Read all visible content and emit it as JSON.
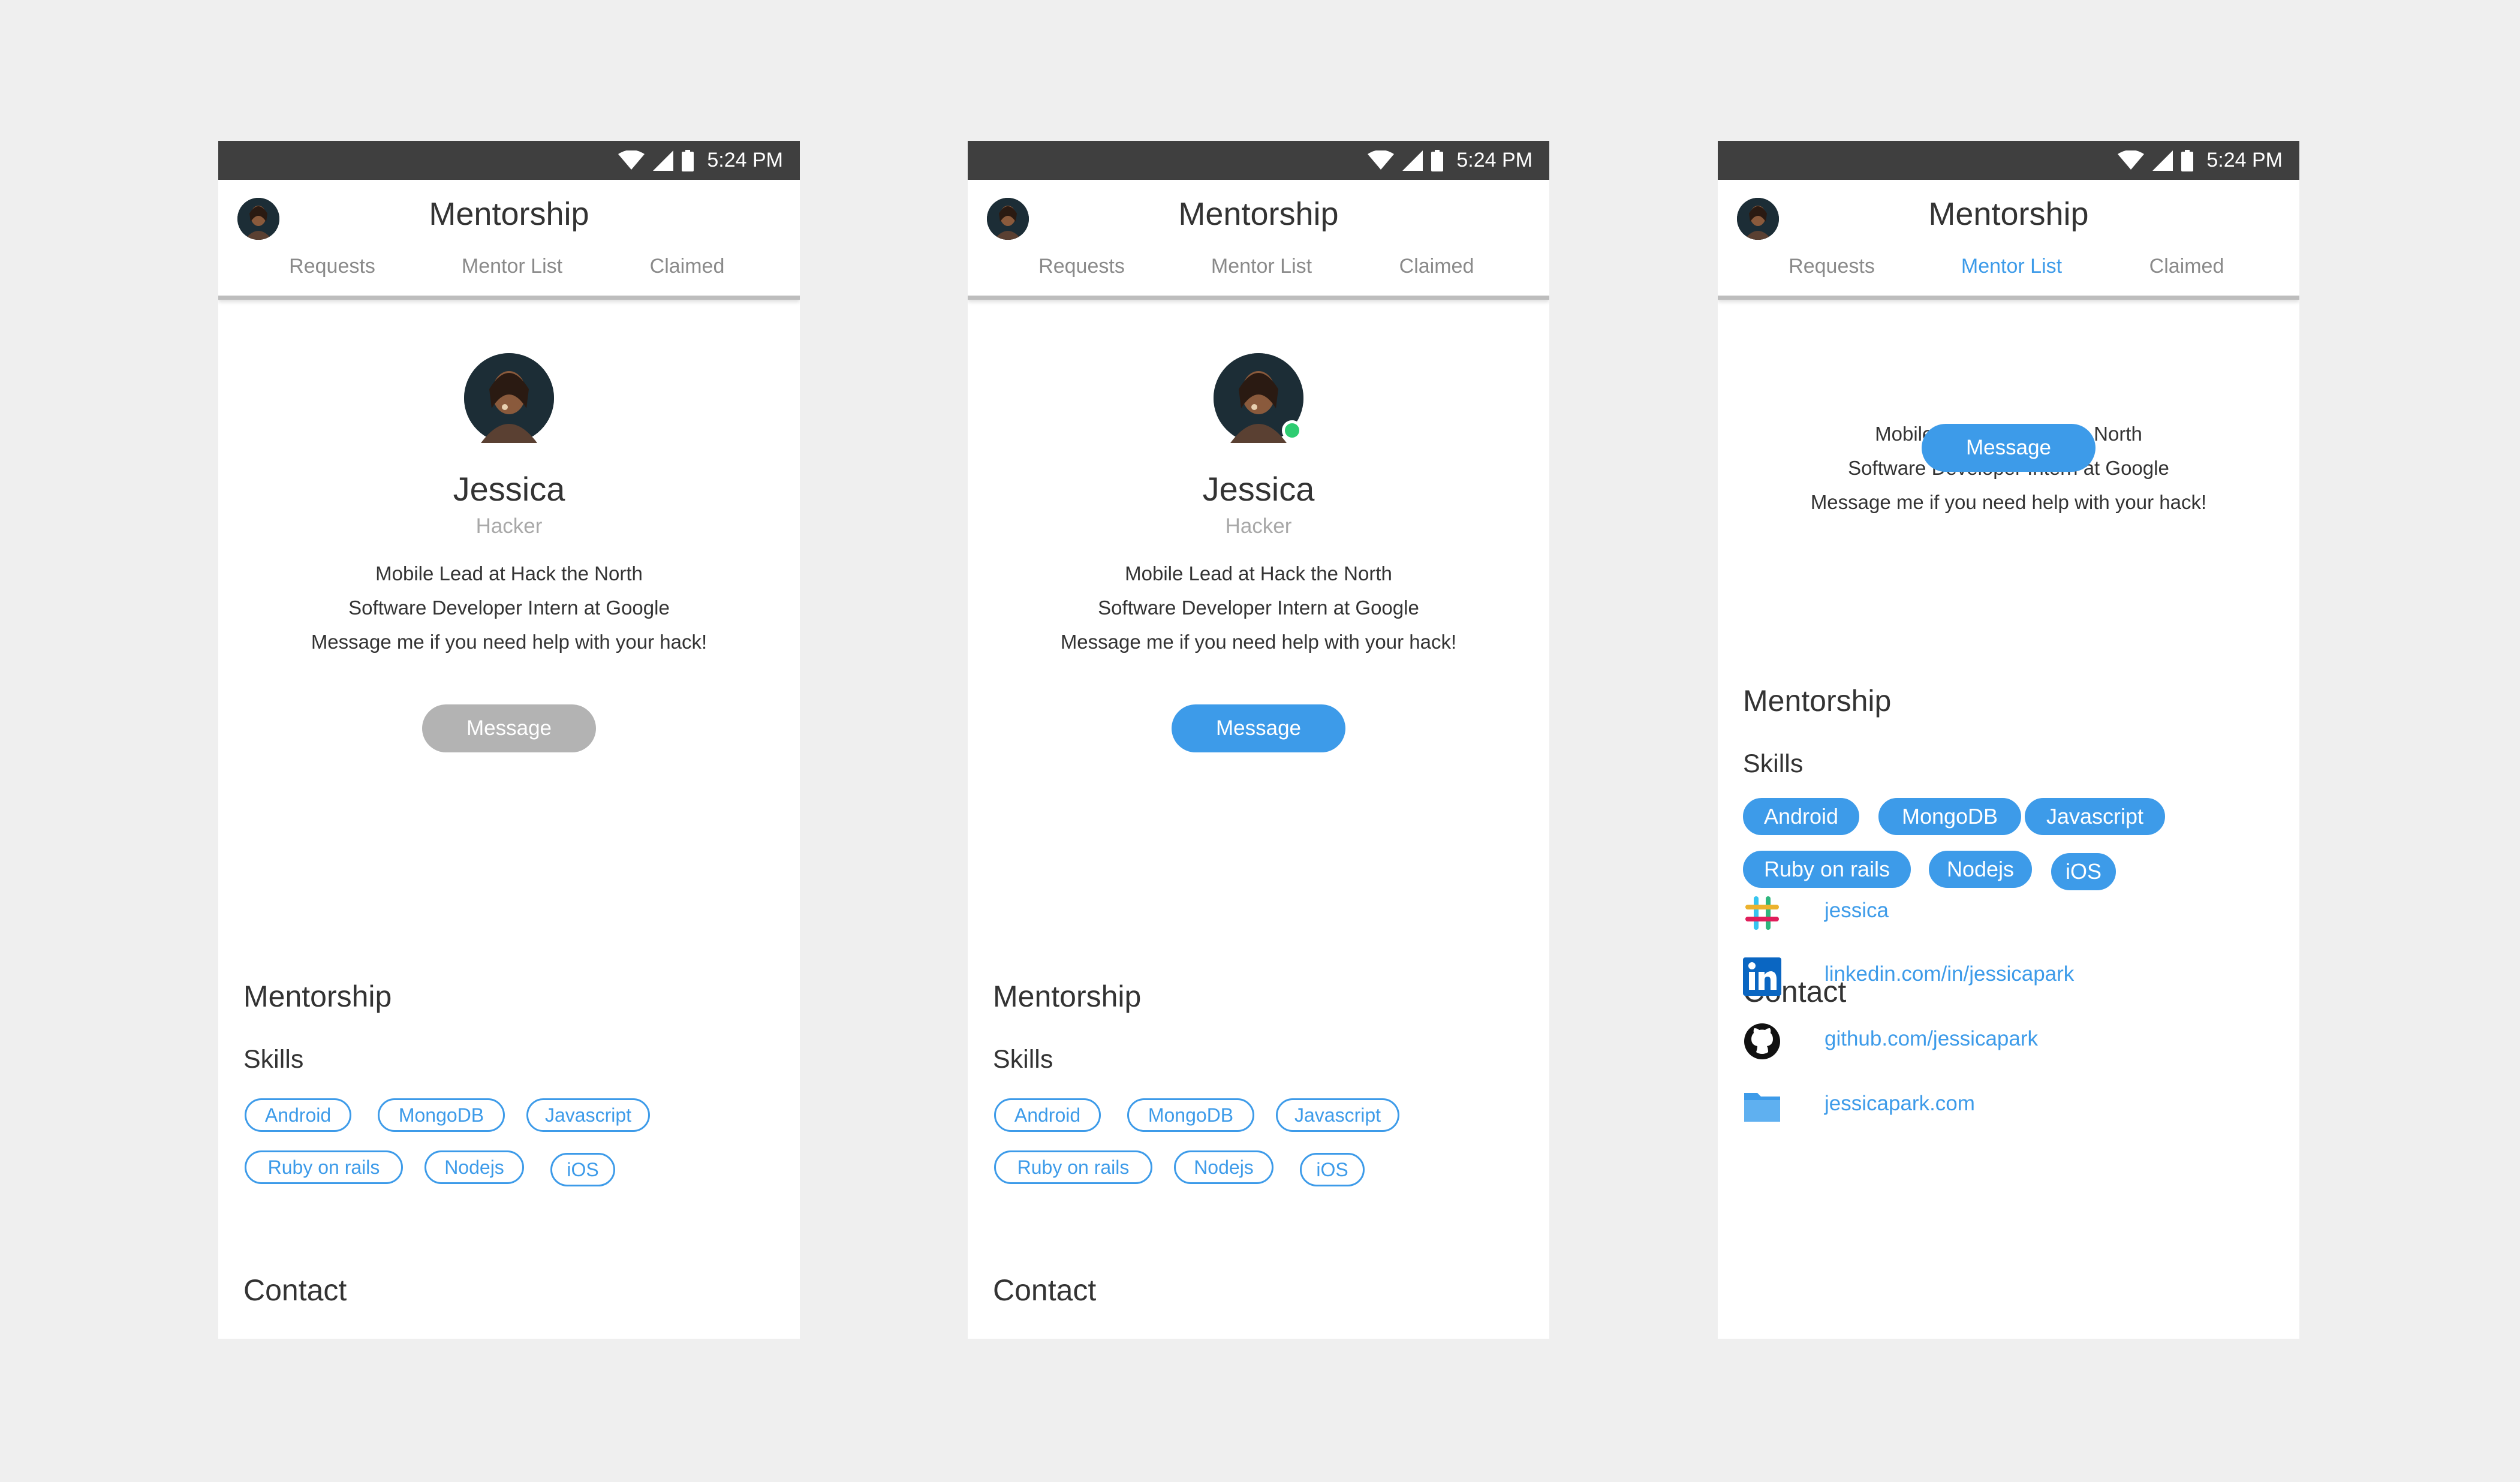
{
  "status_bar": {
    "time": "5:24 PM"
  },
  "app": {
    "title": "Mentorship",
    "tabs": [
      "Requests",
      "Mentor List",
      "Claimed"
    ]
  },
  "profile": {
    "name": "Jessica",
    "role": "Hacker",
    "bio": [
      "Mobile Lead at Hack the North",
      "Software Developer Intern at Google",
      "Message me if you need help with your hack!"
    ],
    "message_label": "Message"
  },
  "mentorship": {
    "title": "Mentorship",
    "skills_title": "Skills",
    "skills": [
      "Android",
      "MongoDB",
      "Javascript",
      "Ruby on rails",
      "Nodejs",
      "iOS"
    ]
  },
  "contact": {
    "title": "Contact",
    "items": [
      {
        "icon": "slack-icon",
        "text": "jessica"
      },
      {
        "icon": "linkedin-icon",
        "text": "linkedin.com/in/jessicapark"
      },
      {
        "icon": "github-icon",
        "text": "github.com/jessicapark"
      },
      {
        "icon": "folder-icon",
        "text": "jessicapark.com"
      }
    ]
  },
  "screens": [
    {
      "active_tab": "none",
      "message_state": "disabled",
      "online": false,
      "skill_style": "outlined"
    },
    {
      "active_tab": "none",
      "message_state": "enabled",
      "online": true,
      "skill_style": "outlined"
    },
    {
      "active_tab": "Mentor List",
      "message_state": "enabled",
      "online": false,
      "skill_style": "filled",
      "scrolled": true
    }
  ],
  "colors": {
    "accent": "#3d9be9",
    "status_bar": "#3f3f3f",
    "disabled_button": "#b3b3b3",
    "online": "#2ecc71",
    "background": "#efefef"
  }
}
